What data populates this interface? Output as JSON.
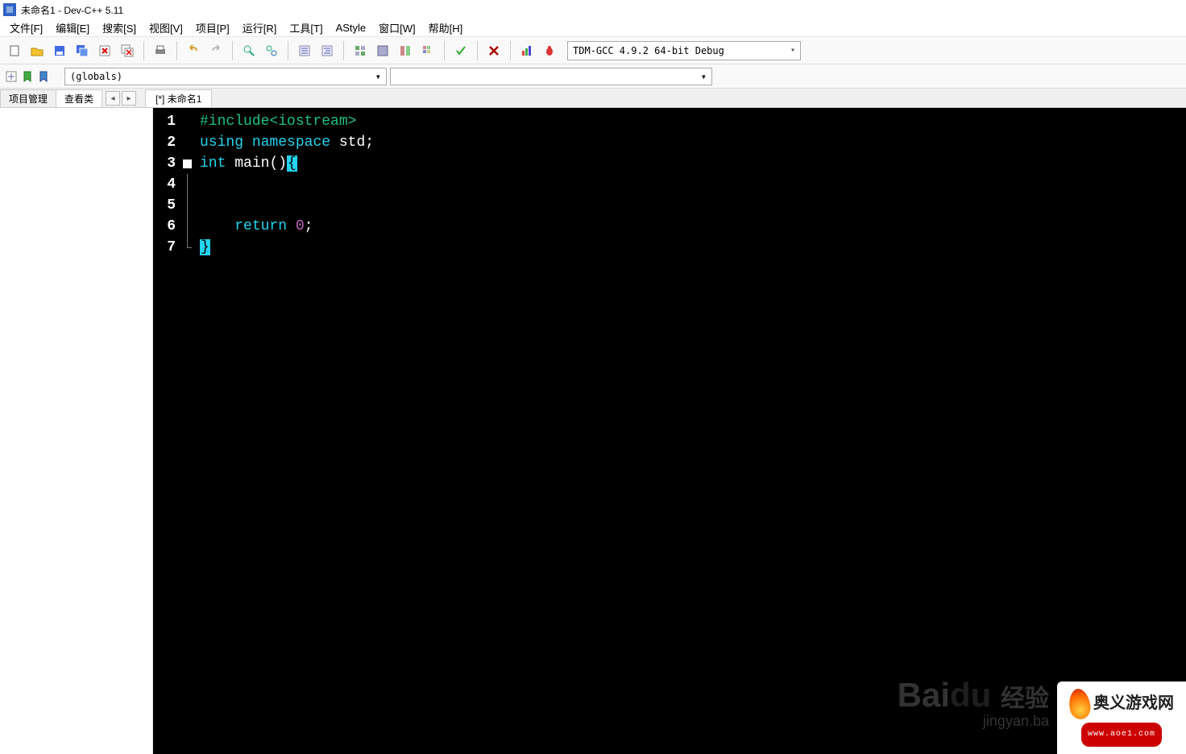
{
  "title": "未命名1 - Dev-C++ 5.11",
  "menu": {
    "file": "文件[F]",
    "edit": "编辑[E]",
    "search": "搜索[S]",
    "view": "视图[V]",
    "project": "项目[P]",
    "run": "运行[R]",
    "tools": "工具[T]",
    "astyle": "AStyle",
    "window": "窗口[W]",
    "help": "帮助[H]"
  },
  "toolbar_icons": {
    "new": "new-file-icon",
    "open": "open-file-icon",
    "save": "save-icon",
    "saveall": "save-all-icon",
    "close": "close-file-icon",
    "closeall": "close-all-icon",
    "print": "print-icon",
    "undo": "undo-icon",
    "redo": "redo-icon",
    "find": "find-icon",
    "replace": "replace-icon",
    "indent": "indent-icon",
    "outdent": "outdent-icon",
    "compile": "compile-icon",
    "run": "run-icon",
    "compilerun": "compile-run-icon",
    "rebuild": "rebuild-icon",
    "debug": "debug-icon",
    "stop": "stop-icon",
    "profiling": "profiling-icon",
    "delete": "delete-icon",
    "chart": "chart-icon",
    "bug": "bug-icon"
  },
  "compiler_selected": "TDM-GCC 4.9.2 64-bit Debug",
  "second_toolbar": {
    "goto": "goto-icon",
    "bookmark": "bookmark-icon",
    "toggle": "toggle-icon",
    "globals_label": "(globals)"
  },
  "panel_tabs": {
    "project": "项目管理",
    "classes": "查看类"
  },
  "file_tab": "[*] 未命名1",
  "code": {
    "lines": [
      {
        "n": "1",
        "tokens": [
          {
            "t": "#include<iostream>",
            "c": "c-pre"
          }
        ]
      },
      {
        "n": "2",
        "tokens": [
          {
            "t": "using",
            "c": "c-kw"
          },
          {
            "t": " ",
            "c": ""
          },
          {
            "t": "namespace",
            "c": "c-kw"
          },
          {
            "t": " ",
            "c": ""
          },
          {
            "t": "std",
            "c": "c-id"
          },
          {
            "t": ";",
            "c": "c-punc"
          }
        ]
      },
      {
        "n": "3",
        "tokens": [
          {
            "t": "int",
            "c": "c-kw"
          },
          {
            "t": " ",
            "c": ""
          },
          {
            "t": "main",
            "c": "c-id"
          },
          {
            "t": "()",
            "c": "c-punc"
          },
          {
            "t": "{",
            "c": "hl-brace"
          }
        ]
      },
      {
        "n": "4",
        "tokens": [
          {
            "t": "",
            "c": ""
          }
        ]
      },
      {
        "n": "5",
        "tokens": [
          {
            "t": "",
            "c": ""
          }
        ]
      },
      {
        "n": "6",
        "tokens": [
          {
            "t": "    ",
            "c": ""
          },
          {
            "t": "return",
            "c": "c-kw"
          },
          {
            "t": " ",
            "c": ""
          },
          {
            "t": "0",
            "c": "c-num"
          },
          {
            "t": ";",
            "c": "c-punc"
          }
        ]
      },
      {
        "n": "7",
        "tokens": [
          {
            "t": "}",
            "c": "hl-brace"
          }
        ]
      }
    ]
  },
  "watermark": {
    "brand": "Bai",
    "brand2": "du",
    "suffix": "经验",
    "sub": "jingyan.ba"
  },
  "badge": {
    "title": "奥义游戏网",
    "url": "www.aoe1.com"
  }
}
